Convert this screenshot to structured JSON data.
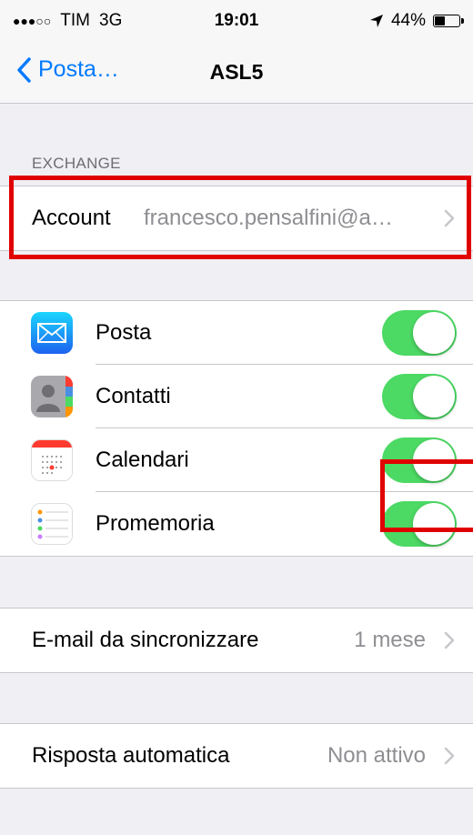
{
  "status_bar": {
    "signal": "●●●○○",
    "carrier": "TIM",
    "network": "3G",
    "time": "19:01",
    "battery_percent": "44%",
    "battery_level": 0.44
  },
  "nav": {
    "back_label": "Posta…",
    "title": "ASL5"
  },
  "exchange_section": {
    "header": "EXCHANGE",
    "account_label": "Account",
    "account_value": "francesco.pensalfini@a…"
  },
  "sync_items": [
    {
      "label": "Posta",
      "icon": "mail-icon",
      "enabled": true
    },
    {
      "label": "Contatti",
      "icon": "contacts-icon",
      "enabled": true
    },
    {
      "label": "Calendari",
      "icon": "calendar-icon",
      "enabled": true
    },
    {
      "label": "Promemoria",
      "icon": "reminders-icon",
      "enabled": true
    }
  ],
  "mail_sync": {
    "label": "E-mail da sincronizzare",
    "value": "1 mese"
  },
  "auto_reply": {
    "label": "Risposta automatica",
    "value": "Non attivo"
  },
  "colors": {
    "accent": "#007aff",
    "toggle_on": "#4cd964",
    "highlight": "#e00000",
    "background": "#efeff4"
  }
}
